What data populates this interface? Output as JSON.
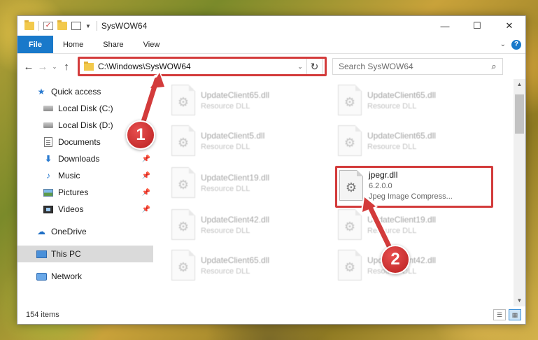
{
  "window": {
    "title": "SysWOW64",
    "controls": {
      "minimize": "—",
      "maximize": "☐",
      "close": "✕"
    }
  },
  "ribbon": {
    "tabs": [
      "File",
      "Home",
      "Share",
      "View"
    ],
    "expand": "⌄",
    "help": "?"
  },
  "navigation": {
    "back": "←",
    "forward": "→",
    "recent": "⌄",
    "up": "↑",
    "address": "C:\\Windows\\SysWOW64",
    "address_drop": "⌄",
    "refresh": "↻",
    "search_placeholder": "Search SysWOW64",
    "search_icon": "⌕"
  },
  "sidebar": {
    "items": [
      {
        "label": "Quick access",
        "icon": "star-icon"
      },
      {
        "label": "Local Disk (C:)",
        "icon": "disk-icon"
      },
      {
        "label": "Local Disk (D:)",
        "icon": "disk-icon"
      },
      {
        "label": "Documents",
        "icon": "document-icon"
      },
      {
        "label": "Downloads",
        "icon": "download-icon"
      },
      {
        "label": "Music",
        "icon": "music-icon"
      },
      {
        "label": "Pictures",
        "icon": "pictures-icon"
      },
      {
        "label": "Videos",
        "icon": "videos-icon"
      },
      {
        "label": "OneDrive",
        "icon": "cloud-icon"
      },
      {
        "label": "This PC",
        "icon": "pc-icon"
      },
      {
        "label": "Network",
        "icon": "network-icon"
      }
    ],
    "pin": "📌"
  },
  "files": [
    {
      "name": "UpdateClient65.dll",
      "desc": "Resource DLL"
    },
    {
      "name": "UpdateClient65.dll",
      "desc": "Resource DLL"
    },
    {
      "name": "UpdateClient5.dll",
      "desc": "Resource DLL"
    },
    {
      "name": "UpdateClient65.dll",
      "desc": "Resource DLL"
    },
    {
      "name": "UpdateClient19.dll",
      "desc": "Resource DLL"
    },
    {
      "name": "jpegr.dll",
      "version": "6.2.0.0",
      "desc": "Jpeg Image Compress..."
    },
    {
      "name": "UpdateClient42.dll",
      "desc": "Resource DLL"
    },
    {
      "name": "UpdateClient19.dll",
      "desc": "Resource DLL"
    },
    {
      "name": "UpdateClient65.dll",
      "desc": "Resource DLL"
    },
    {
      "name": "UpdateClient42.dll",
      "desc": "Resource DLL"
    }
  ],
  "scrollbar": {
    "up": "▲",
    "down": "▼"
  },
  "status": {
    "count": "154 items",
    "details_view": "☰",
    "icons_view": "▦"
  },
  "callouts": {
    "first": "1",
    "second": "2"
  },
  "colors": {
    "accent": "#1979ca",
    "highlight": "#d33b3b",
    "selected": "#dadada"
  }
}
